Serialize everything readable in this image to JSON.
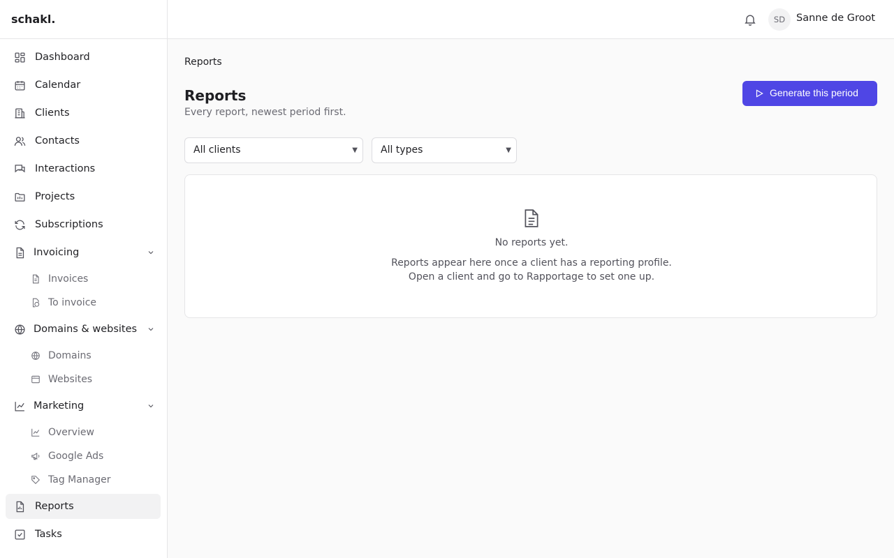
{
  "app": {
    "logo": "schakl."
  },
  "header": {
    "avatar_initials": "SD",
    "user_name": "Sanne de Groot",
    "notifications_icon": "bell-icon"
  },
  "sidebar": {
    "items": [
      {
        "label": "Dashboard",
        "icon": "dashboard-icon"
      },
      {
        "label": "Calendar",
        "icon": "calendar-icon"
      },
      {
        "label": "Clients",
        "icon": "building-icon"
      },
      {
        "label": "Contacts",
        "icon": "users-icon"
      },
      {
        "label": "Interactions",
        "icon": "chat-icon"
      },
      {
        "label": "Projects",
        "icon": "folder-icon"
      },
      {
        "label": "Subscriptions",
        "icon": "refresh-icon"
      },
      {
        "label": "Invoicing",
        "icon": "document-icon",
        "expanded": true
      },
      {
        "label": "Domains & websites",
        "icon": "globe-icon",
        "expanded": true
      },
      {
        "label": "Marketing",
        "icon": "chart-icon",
        "expanded": true
      },
      {
        "label": "Reports",
        "icon": "report-icon",
        "active": true
      },
      {
        "label": "Tasks",
        "icon": "checkbox-icon"
      }
    ],
    "invoicing_children": [
      {
        "label": "Invoices",
        "icon": "file-icon"
      },
      {
        "label": "To invoice",
        "icon": "coins-icon"
      }
    ],
    "domains_children": [
      {
        "label": "Domains",
        "icon": "globe-icon"
      },
      {
        "label": "Websites",
        "icon": "browser-icon"
      }
    ],
    "marketing_children": [
      {
        "label": "Overview",
        "icon": "chart-icon"
      },
      {
        "label": "Google Ads",
        "icon": "megaphone-icon"
      },
      {
        "label": "Tag Manager",
        "icon": "tag-icon"
      }
    ]
  },
  "page": {
    "breadcrumb": "Reports",
    "title": "Reports",
    "subtitle": "Every report, newest period first.",
    "generate_button": "Generate this period"
  },
  "filters": {
    "client": "All clients",
    "type": "All types"
  },
  "empty_state": {
    "icon": "document-icon",
    "title": "No reports yet.",
    "description": "Reports appear here once a client has a reporting profile. Open a client and go to Rapportage to set one up."
  }
}
